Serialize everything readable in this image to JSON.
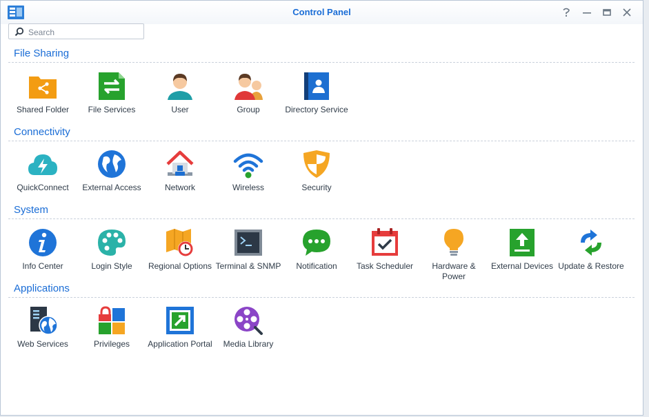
{
  "window": {
    "title": "Control Panel"
  },
  "search": {
    "placeholder": "Search"
  },
  "sections": [
    {
      "title": "File Sharing",
      "items": [
        {
          "label": "Shared Folder",
          "icon": "shared-folder-icon"
        },
        {
          "label": "File Services",
          "icon": "file-services-icon"
        },
        {
          "label": "User",
          "icon": "user-icon"
        },
        {
          "label": "Group",
          "icon": "group-icon"
        },
        {
          "label": "Directory Service",
          "icon": "directory-service-icon"
        }
      ]
    },
    {
      "title": "Connectivity",
      "items": [
        {
          "label": "QuickConnect",
          "icon": "quickconnect-icon"
        },
        {
          "label": "External Access",
          "icon": "globe-icon"
        },
        {
          "label": "Network",
          "icon": "network-house-icon"
        },
        {
          "label": "Wireless",
          "icon": "wifi-icon"
        },
        {
          "label": "Security",
          "icon": "shield-icon"
        }
      ]
    },
    {
      "title": "System",
      "items": [
        {
          "label": "Info Center",
          "icon": "info-icon"
        },
        {
          "label": "Login Style",
          "icon": "palette-icon"
        },
        {
          "label": "Regional Options",
          "icon": "map-clock-icon"
        },
        {
          "label": "Terminal & SNMP",
          "icon": "terminal-icon"
        },
        {
          "label": "Notification",
          "icon": "chat-bubble-icon"
        },
        {
          "label": "Task Scheduler",
          "icon": "calendar-check-icon"
        },
        {
          "label": "Hardware & Power",
          "icon": "lightbulb-icon"
        },
        {
          "label": "External Devices",
          "icon": "external-device-icon"
        },
        {
          "label": "Update & Restore",
          "icon": "refresh-icon"
        }
      ]
    },
    {
      "title": "Applications",
      "items": [
        {
          "label": "Web Services",
          "icon": "web-services-icon"
        },
        {
          "label": "Privileges",
          "icon": "privileges-icon"
        },
        {
          "label": "Application Portal",
          "icon": "portal-icon"
        },
        {
          "label": "Media Library",
          "icon": "film-reel-icon"
        }
      ]
    }
  ],
  "colors": {
    "accent": "#1a6dd6",
    "text": "#2f3b48"
  }
}
